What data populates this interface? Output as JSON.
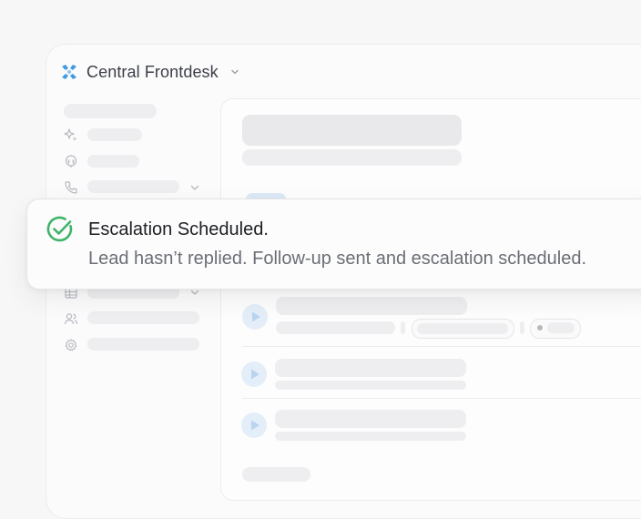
{
  "workspace": {
    "name": "Central Frontdesk",
    "logo_icon": "brand-logo-icon",
    "accent_color": "#3d9be0"
  },
  "sidebar": {
    "icons": [
      "sparkle-icon",
      "headset-icon",
      "phone-icon",
      "table-icon",
      "users-icon",
      "gear-icon"
    ]
  },
  "toast": {
    "title": "Escalation Scheduled.",
    "message": "Lead hasn’t replied. Follow-up sent and escalation scheduled.",
    "status_icon": "check-circle-icon",
    "status_color": "#3fb468"
  },
  "main": {
    "row_icon": "play-icon"
  }
}
